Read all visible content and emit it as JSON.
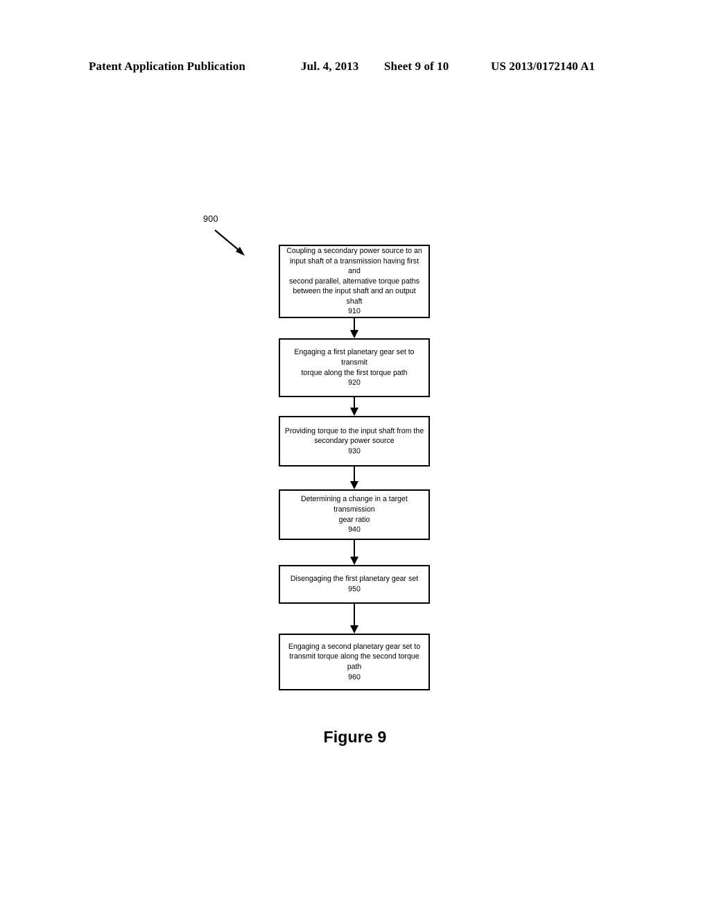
{
  "header": {
    "publication": "Patent Application Publication",
    "date": "Jul. 4, 2013",
    "sheet": "Sheet 9 of 10",
    "patent_number": "US 2013/0172140 A1"
  },
  "figure": {
    "reference_label": "900",
    "caption": "Figure 9"
  },
  "flowchart": {
    "steps": [
      {
        "id": "910",
        "text": "Coupling a secondary power source to an\ninput shaft of a transmission having first and\nsecond parallel, alternative torque paths\nbetween the input shaft and an output shaft\n910"
      },
      {
        "id": "920",
        "text": "Engaging a first planetary gear set to transmit\ntorque along the first torque path\n920"
      },
      {
        "id": "930",
        "text": "Providing torque to the input shaft from the\nsecondary power source\n930"
      },
      {
        "id": "940",
        "text": "Determining a change in a target transmission\ngear ratio\n940"
      },
      {
        "id": "950",
        "text": "Disengaging the first planetary gear set\n950"
      },
      {
        "id": "960",
        "text": "Engaging a second planetary gear set to\ntransmit torque along the second torque path\n960"
      }
    ]
  },
  "colors": {
    "ink": "#000000",
    "paper": "#ffffff"
  }
}
